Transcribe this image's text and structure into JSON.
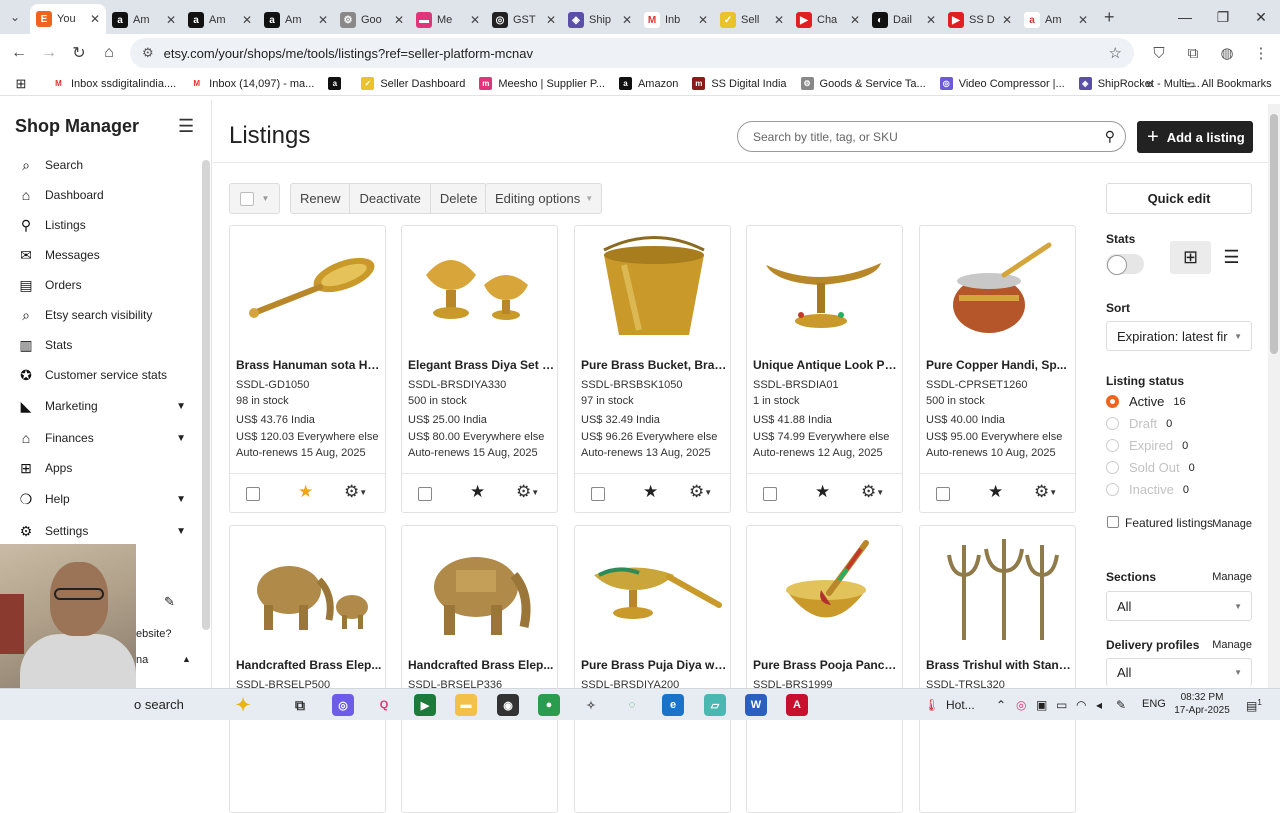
{
  "browser": {
    "tabs": [
      {
        "label": "You",
        "color": "#f1641e",
        "glyph": "E"
      },
      {
        "label": "Am",
        "color": "#111111",
        "glyph": "a"
      },
      {
        "label": "Am",
        "color": "#111111",
        "glyph": "a"
      },
      {
        "label": "Am",
        "color": "#111111",
        "glyph": "a"
      },
      {
        "label": "Goo",
        "color": "#888888",
        "glyph": "⚙"
      },
      {
        "label": "Me",
        "color": "#e0357a",
        "glyph": "▬"
      },
      {
        "label": "GST",
        "color": "#222222",
        "glyph": "◎"
      },
      {
        "label": "Ship",
        "color": "#5a4ea8",
        "glyph": "◈"
      },
      {
        "label": "Inb",
        "color": "#ffffff",
        "glyph": "M"
      },
      {
        "label": "Sell",
        "color": "#e9c32b",
        "glyph": "✓"
      },
      {
        "label": "Cha",
        "color": "#e02020",
        "glyph": "▶"
      },
      {
        "label": "Dail",
        "color": "#111111",
        "glyph": "◐"
      },
      {
        "label": "SS D",
        "color": "#e02020",
        "glyph": "▶"
      },
      {
        "label": "Am",
        "color": "#ffffff",
        "glyph": "a"
      }
    ],
    "url": "etsy.com/your/shops/me/tools/listings?ref=seller-platform-mcnav",
    "bookmarks": [
      {
        "label": "Inbox ssdigitalindia....",
        "color": "#ffffff",
        "glyph": "M"
      },
      {
        "label": "Inbox (14,097) - ma...",
        "color": "#ffffff",
        "glyph": "M"
      },
      {
        "label": "",
        "color": "#111111",
        "glyph": "a"
      },
      {
        "label": "Seller Dashboard",
        "color": "#e9c32b",
        "glyph": "✓"
      },
      {
        "label": "Meesho | Supplier P...",
        "color": "#e0357a",
        "glyph": "m"
      },
      {
        "label": "Amazon",
        "color": "#111111",
        "glyph": "a"
      },
      {
        "label": "SS Digital India",
        "color": "#8b1a1a",
        "glyph": "m"
      },
      {
        "label": "Goods & Service Ta...",
        "color": "#888888",
        "glyph": "⚙"
      },
      {
        "label": "Video Compressor |...",
        "color": "#6b5bd6",
        "glyph": "◎"
      },
      {
        "label": "ShipRocket - Multi-...",
        "color": "#5a4ea8",
        "glyph": "◈"
      }
    ],
    "all_bookmarks": "All Bookmarks"
  },
  "sidebar": {
    "title": "Shop Manager",
    "items": [
      {
        "label": "Search",
        "icon": "search-icon",
        "glyph": "⌕"
      },
      {
        "label": "Dashboard",
        "icon": "home-icon",
        "glyph": "⌂"
      },
      {
        "label": "Listings",
        "icon": "listings-icon",
        "glyph": "⚲"
      },
      {
        "label": "Messages",
        "icon": "messages-icon",
        "glyph": "✉"
      },
      {
        "label": "Orders",
        "icon": "orders-icon",
        "glyph": "▤"
      },
      {
        "label": "Etsy search visibility",
        "icon": "visibility-icon",
        "glyph": "⌕"
      },
      {
        "label": "Stats",
        "icon": "stats-icon",
        "glyph": "▥"
      },
      {
        "label": "Customer service stats",
        "icon": "badge-icon",
        "glyph": "✪"
      },
      {
        "label": "Marketing",
        "icon": "megaphone-icon",
        "glyph": "◣",
        "chev": true
      },
      {
        "label": "Finances",
        "icon": "bank-icon",
        "glyph": "⌂",
        "chev": true
      },
      {
        "label": "Apps",
        "icon": "apps-icon",
        "glyph": "⊞"
      },
      {
        "label": "Help",
        "icon": "help-icon",
        "glyph": "❍",
        "chev": true
      },
      {
        "label": "Settings",
        "icon": "gear-icon",
        "glyph": "⚙",
        "chev": true
      }
    ],
    "tail_line1": "ebsite?",
    "tail_line2": "na"
  },
  "main": {
    "title": "Listings",
    "search_placeholder": "Search by title, tag, or SKU",
    "add_button": "Add a listing",
    "toolbar": {
      "renew": "Renew",
      "deactivate": "Deactivate",
      "delete": "Delete",
      "editing_options": "Editing options"
    },
    "listings": [
      {
        "title": "Brass Hanuman sota Ha...",
        "sku": "SSDL-GD1050",
        "stock": "98 in stock",
        "price_india": "US$ 43.76 India",
        "price_else": "US$ 120.03 Everywhere else",
        "renews": "Auto-renews 15 Aug, 2025",
        "featured": true,
        "img": "gada"
      },
      {
        "title": "Elegant Brass Diya Set - ...",
        "sku": "SSDL-BRSDIYA330",
        "stock": "500 in stock",
        "price_india": "US$ 25.00 India",
        "price_else": "US$ 80.00 Everywhere else",
        "renews": "Auto-renews 15 Aug, 2025",
        "featured": false,
        "img": "diyaset"
      },
      {
        "title": "Pure Brass Bucket, Bras...",
        "sku": "SSDL-BRSBSK1050",
        "stock": "97 in stock",
        "price_india": "US$ 32.49 India",
        "price_else": "US$ 96.26 Everywhere else",
        "renews": "Auto-renews 13 Aug, 2025",
        "featured": false,
        "img": "bucket"
      },
      {
        "title": "Unique Antique Look Po...",
        "sku": "SSDL-BRSDIA01",
        "stock": "1 in stock",
        "price_india": "US$ 41.88 India",
        "price_else": "US$ 74.99 Everywhere else",
        "renews": "Auto-renews 12 Aug, 2025",
        "featured": false,
        "img": "antique"
      },
      {
        "title": "Pure Copper Handi, Sp...",
        "sku": "SSDL-CPRSET1260",
        "stock": "500 in stock",
        "price_india": "US$ 40.00 India",
        "price_else": "US$ 95.00 Everywhere else",
        "renews": "Auto-renews 10 Aug, 2025",
        "featured": false,
        "img": "handi"
      },
      {
        "title": "Handcrafted Brass Elep...",
        "sku": "SSDL-BRSELP500",
        "img": "elephants"
      },
      {
        "title": "Handcrafted Brass Elep...",
        "sku": "SSDL-BRSELP336",
        "img": "elephant"
      },
      {
        "title": "Pure Brass Puja Diya wit...",
        "sku": "SSDL-BRSDIYA200",
        "img": "pujadiya"
      },
      {
        "title": "Pure Brass Pooja Panch ...",
        "sku": "SSDL-BRS1999",
        "img": "panch"
      },
      {
        "title": "Brass Trishul with Stand...",
        "sku": "SSDL-TRSL320",
        "img": "trishul"
      }
    ]
  },
  "right_panel": {
    "quick_edit": "Quick edit",
    "stats_label": "Stats",
    "sort_label": "Sort",
    "sort_value": "Expiration: latest fir",
    "status_label": "Listing status",
    "statuses": [
      {
        "label": "Active",
        "count": "16",
        "selected": true
      },
      {
        "label": "Draft",
        "count": "0"
      },
      {
        "label": "Expired",
        "count": "0"
      },
      {
        "label": "Sold Out",
        "count": "0"
      },
      {
        "label": "Inactive",
        "count": "0"
      }
    ],
    "featured_label": "Featured listings",
    "manage": "Manage",
    "sections_label": "Sections",
    "sections_value": "All",
    "delivery_label": "Delivery profiles",
    "delivery_value": "All"
  },
  "taskbar": {
    "search_label": "o search",
    "weather": "Hot...",
    "lang": "ENG",
    "time": "08:32 PM",
    "date": "17-Apr-2025",
    "notif_count": "1"
  }
}
